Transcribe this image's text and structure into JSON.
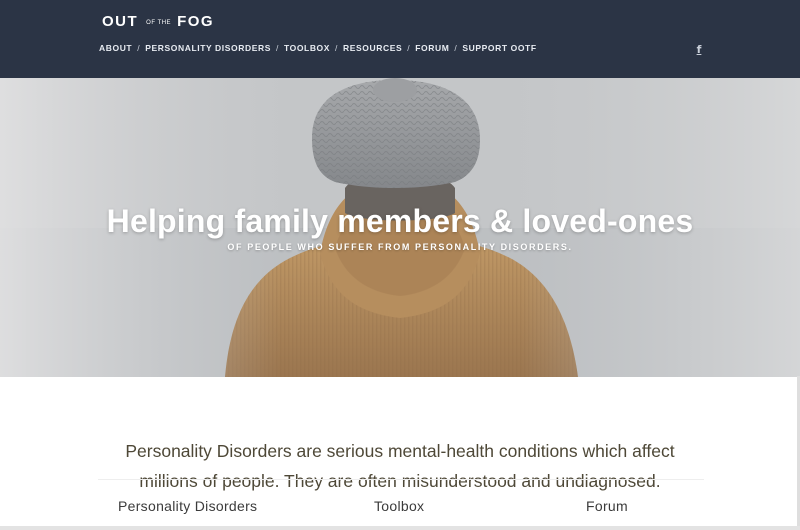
{
  "logo": {
    "part1": "OUT",
    "part2": "OF THE",
    "part3": "FOG"
  },
  "nav": {
    "items": [
      "ABOUT",
      "PERSONALITY DISORDERS",
      "TOOLBOX",
      "RESOURCES",
      "FORUM",
      "SUPPORT OOTF"
    ],
    "separator": "/"
  },
  "social": {
    "facebook_glyph": "f",
    "icon": "facebook-icon"
  },
  "hero": {
    "title": "Helping family members & loved-ones",
    "subtitle": "OF PEOPLE WHO SUFFER FROM PERSONALITY DISORDERS."
  },
  "intro": {
    "text": "Personality Disorders are serious mental-health conditions which affect millions of people. They are often misunderstood and undiagnosed."
  },
  "links": [
    "Personality Disorders",
    "Toolbox",
    "Forum"
  ],
  "colors": {
    "header_bg": "#2b3445",
    "intro_text": "#4e4837",
    "jacket": "#b07a3a",
    "beanie": "#8a8c90"
  }
}
